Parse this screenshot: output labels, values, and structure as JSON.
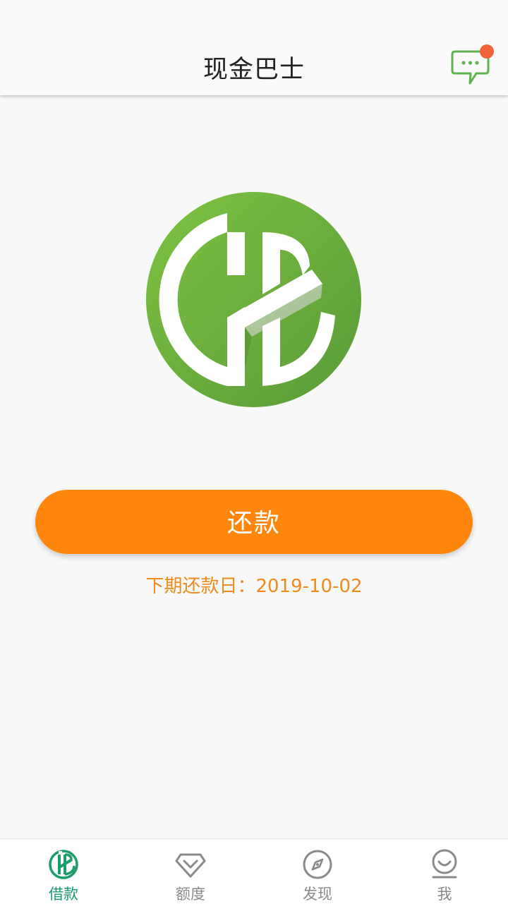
{
  "app": {
    "title": "现金巴士"
  },
  "header": {
    "message_icon": "chat-bubble-icon",
    "has_notification": true
  },
  "main": {
    "repay_button_label": "还款",
    "next_due_label": "下期还款日：",
    "next_due_date": "2019-10-02"
  },
  "tabs": [
    {
      "label": "借款",
      "icon": "loan-logo-icon",
      "active": true
    },
    {
      "label": "额度",
      "icon": "diamond-icon",
      "active": false
    },
    {
      "label": "发现",
      "icon": "compass-icon",
      "active": false
    },
    {
      "label": "我",
      "icon": "smiley-face-icon",
      "active": false
    }
  ],
  "colors": {
    "brand_green": "#6bb23f",
    "accent_orange": "#ff860d",
    "due_text": "#f08a1d",
    "active_tab": "#1a9d6a",
    "notification_dot": "#f0633b"
  }
}
